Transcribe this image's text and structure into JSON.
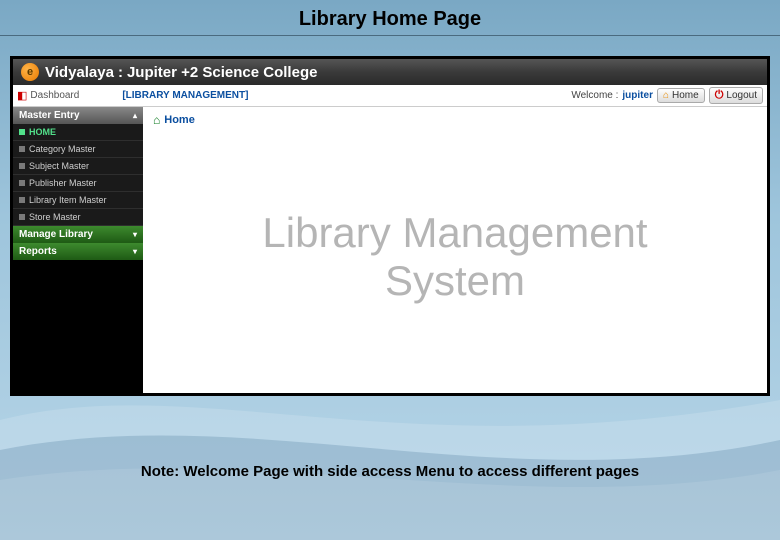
{
  "slide": {
    "title": "Library Home Page",
    "note": "Note: Welcome Page with side access Menu to access different pages"
  },
  "titlebar": {
    "app_name": "Vidyalaya",
    "separator": ":",
    "institution": "Jupiter +2 Science College"
  },
  "crumb": {
    "dashboard": "Dashboard",
    "module": "[LIBRARY MANAGEMENT]",
    "welcome_label": "Welcome :",
    "welcome_user": "jupiter",
    "home_btn": "Home",
    "logout_btn": "Logout"
  },
  "sidebar": {
    "section_master": "Master Entry",
    "items": [
      {
        "label": "HOME",
        "active": true
      },
      {
        "label": "Category Master",
        "active": false
      },
      {
        "label": "Subject Master",
        "active": false
      },
      {
        "label": "Publisher Master",
        "active": false
      },
      {
        "label": "Library Item Master",
        "active": false
      },
      {
        "label": "Store Master",
        "active": false
      }
    ],
    "section_manage": "Manage Library",
    "section_reports": "Reports"
  },
  "content": {
    "breadcrumb_home": "Home",
    "hero_line1": "Library Management",
    "hero_line2": "System"
  }
}
